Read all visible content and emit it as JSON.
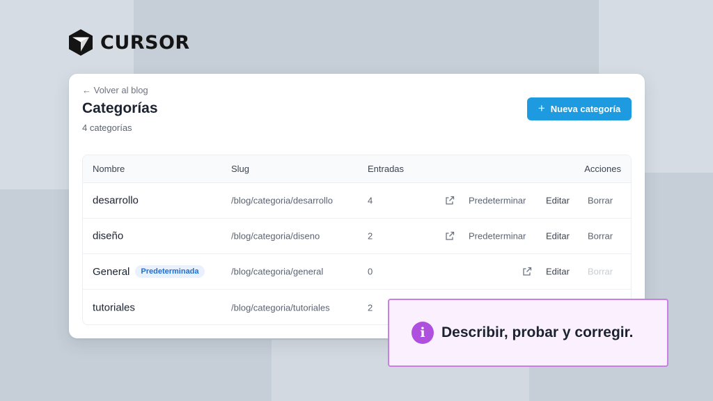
{
  "brand": {
    "name": "CURSOR",
    "logo_icon": "cursor-cube-logo"
  },
  "header": {
    "back_link": "← Volver al blog",
    "title": "Categorías",
    "count": "4 categorías",
    "new_button": {
      "label": "Nueva categoría",
      "icon": "plus-icon"
    }
  },
  "table": {
    "columns": {
      "name": "Nombre",
      "slug": "Slug",
      "posts": "Entradas",
      "actions": "Acciones"
    },
    "rows": [
      {
        "name": "desarrollo",
        "slug": "/blog/categoria/desarrollo",
        "posts": "4",
        "badge": "",
        "set_default": "Predeterminar",
        "edit": "Editar",
        "delete": "Borrar",
        "delete_disabled": false
      },
      {
        "name": "diseño",
        "slug": "/blog/categoria/diseno",
        "posts": "2",
        "badge": "",
        "set_default": "Predeterminar",
        "edit": "Editar",
        "delete": "Borrar",
        "delete_disabled": false
      },
      {
        "name": "General",
        "slug": "/blog/categoria/general",
        "posts": "0",
        "badge": "Predeterminada",
        "set_default": "",
        "edit": "Editar",
        "delete": "Borrar",
        "delete_disabled": true
      },
      {
        "name": "tutoriales",
        "slug": "/blog/categoria/tutoriales",
        "posts": "2",
        "badge": "",
        "set_default": "",
        "edit": "",
        "delete": "",
        "delete_disabled": false
      }
    ]
  },
  "callout": {
    "icon": "info-icon",
    "icon_glyph": "i",
    "text": "Describir, probar y corregir."
  },
  "colors": {
    "accent": "#1e9be0",
    "callout_border": "#c77fe3",
    "callout_icon": "#ae4fde",
    "badge_text": "#1d6fd1"
  }
}
